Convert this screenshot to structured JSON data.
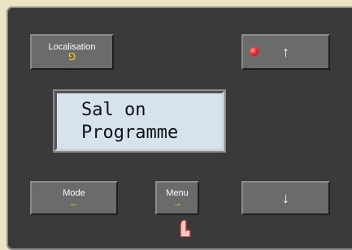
{
  "device": {
    "buttons": {
      "localisation": {
        "label": "Localisation",
        "symbol": "⅁"
      },
      "up": {
        "symbol": "↑",
        "led_color": "#ff2a2a"
      },
      "mode": {
        "label": "Mode",
        "symbol": "←"
      },
      "menu": {
        "label": "Menu",
        "symbol": "→"
      },
      "down": {
        "symbol": "↓"
      }
    },
    "display": {
      "line1": "Sal on",
      "line2": "Programme"
    }
  }
}
